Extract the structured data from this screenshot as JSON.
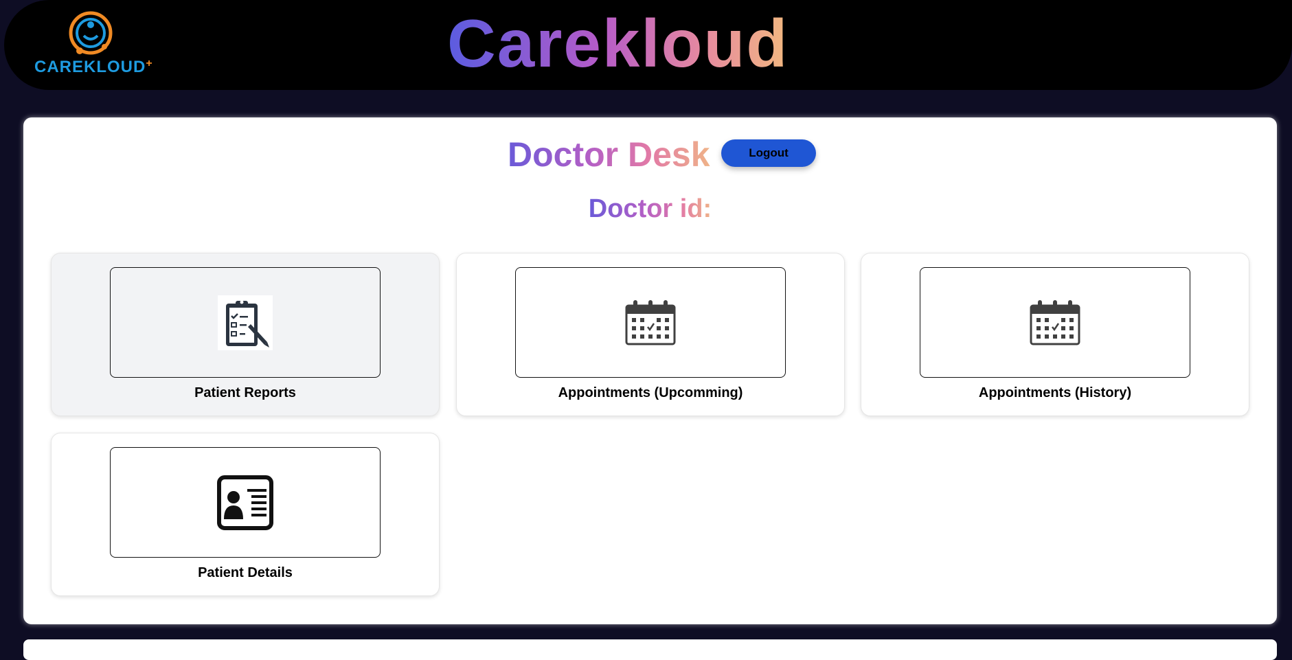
{
  "header": {
    "logo_text": "CAREKLOUD",
    "title": "Carekloud"
  },
  "panel": {
    "title": "Doctor Desk",
    "logout_label": "Logout",
    "doctor_id_label": "Doctor id:"
  },
  "cards": [
    {
      "label": "Patient Reports",
      "icon": "clipboard-checklist-icon"
    },
    {
      "label": "Appointments (Upcomming)",
      "icon": "calendar-icon"
    },
    {
      "label": "Appointments (History)",
      "icon": "calendar-icon"
    },
    {
      "label": "Patient Details",
      "icon": "id-card-icon"
    }
  ],
  "colors": {
    "background": "#0e0d24",
    "header": "#000000",
    "logout_button": "#1f56d4",
    "logo_blue": "#1e9be0",
    "logo_orange": "#f08a24"
  }
}
